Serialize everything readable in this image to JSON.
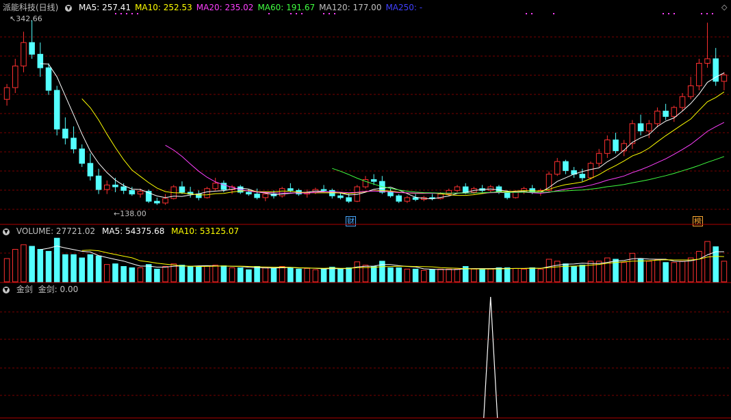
{
  "stock": {
    "name": "派能科技(日线)",
    "ma_labels": [
      {
        "text": "MA5: 257.41",
        "color": "#ffffff"
      },
      {
        "text": "MA10: 252.53",
        "color": "#ffff00"
      },
      {
        "text": "MA20: 235.02",
        "color": "#ff40ff"
      },
      {
        "text": "MA60: 191.67",
        "color": "#40ff40"
      },
      {
        "text": "MA120: 177.00",
        "color": "#c0c0c0"
      },
      {
        "text": "MA250: -",
        "color": "#4040ff"
      }
    ],
    "high_label": "342.66",
    "low_label": "138.00",
    "events": [
      {
        "label": "财"
      },
      {
        "label": "榜"
      }
    ]
  },
  "volume": {
    "title": "VOLUME: 27721.02",
    "ma5": "MA5: 54375.68",
    "ma10": "MA10: 53125.07"
  },
  "indicator": {
    "title": "金剑",
    "value_label": "金剑: 0.00"
  },
  "colors": {
    "up": "#ff3030",
    "down": "#54ffff",
    "grid": "#7a0000",
    "background": "#000000"
  },
  "chart_data": {
    "type": "candlestick",
    "note_symbol": "派能科技",
    "price_range": [
      138.0,
      342.66
    ],
    "candles": [
      [
        255,
        272,
        248,
        268
      ],
      [
        268,
        300,
        262,
        292
      ],
      [
        292,
        330,
        285,
        318
      ],
      [
        318,
        342.66,
        300,
        305
      ],
      [
        305,
        318,
        280,
        290
      ],
      [
        290,
        295,
        260,
        265
      ],
      [
        265,
        270,
        215,
        222
      ],
      [
        222,
        235,
        205,
        212
      ],
      [
        212,
        225,
        195,
        200
      ],
      [
        200,
        205,
        180,
        184
      ],
      [
        184,
        195,
        165,
        170
      ],
      [
        170,
        178,
        150,
        155
      ],
      [
        155,
        165,
        150,
        160
      ],
      [
        160,
        168,
        152,
        158
      ],
      [
        158,
        162,
        150,
        154
      ],
      [
        154,
        158,
        148,
        150
      ],
      [
        150,
        156,
        146,
        153
      ],
      [
        153,
        155,
        140,
        142
      ],
      [
        142,
        146,
        138,
        140
      ],
      [
        140,
        150,
        138.0,
        145
      ],
      [
        145,
        160,
        144,
        158
      ],
      [
        158,
        164,
        150,
        152
      ],
      [
        152,
        158,
        146,
        150
      ],
      [
        150,
        154,
        143,
        146
      ],
      [
        146,
        158,
        145,
        156
      ],
      [
        156,
        168,
        154,
        162
      ],
      [
        162,
        165,
        152,
        155
      ],
      [
        155,
        160,
        150,
        158
      ],
      [
        158,
        160,
        150,
        152
      ],
      [
        152,
        155,
        148,
        150
      ],
      [
        150,
        156,
        144,
        146
      ],
      [
        146,
        152,
        142,
        150
      ],
      [
        150,
        154,
        145,
        148
      ],
      [
        148,
        158,
        146,
        156
      ],
      [
        156,
        162,
        152,
        154
      ],
      [
        154,
        156,
        148,
        150
      ],
      [
        150,
        155,
        146,
        152
      ],
      [
        152,
        157,
        150,
        155
      ],
      [
        155,
        160,
        152,
        154
      ],
      [
        154,
        156,
        145,
        148
      ],
      [
        148,
        152,
        144,
        146
      ],
      [
        146,
        150,
        140,
        142
      ],
      [
        142,
        160,
        141,
        158
      ],
      [
        158,
        170,
        156,
        166
      ],
      [
        166,
        172,
        160,
        164
      ],
      [
        164,
        170,
        150,
        152
      ],
      [
        152,
        156,
        146,
        148
      ],
      [
        148,
        150,
        140,
        142
      ],
      [
        142,
        148,
        140,
        146
      ],
      [
        146,
        150,
        142,
        144
      ],
      [
        144,
        148,
        142,
        146
      ],
      [
        146,
        150,
        143,
        145
      ],
      [
        145,
        152,
        144,
        150
      ],
      [
        150,
        156,
        148,
        154
      ],
      [
        154,
        160,
        152,
        158
      ],
      [
        158,
        162,
        150,
        152
      ],
      [
        152,
        158,
        150,
        156
      ],
      [
        156,
        160,
        152,
        154
      ],
      [
        154,
        160,
        152,
        158
      ],
      [
        158,
        160,
        150,
        152
      ],
      [
        152,
        154,
        144,
        146
      ],
      [
        146,
        154,
        145,
        152
      ],
      [
        152,
        158,
        150,
        156
      ],
      [
        156,
        160,
        150,
        152
      ],
      [
        152,
        156,
        148,
        154
      ],
      [
        154,
        175,
        152,
        172
      ],
      [
        172,
        190,
        170,
        186
      ],
      [
        186,
        188,
        172,
        176
      ],
      [
        176,
        180,
        168,
        172
      ],
      [
        172,
        178,
        164,
        168
      ],
      [
        168,
        186,
        166,
        184
      ],
      [
        184,
        200,
        180,
        195
      ],
      [
        195,
        215,
        190,
        210
      ],
      [
        210,
        218,
        195,
        198
      ],
      [
        198,
        210,
        192,
        206
      ],
      [
        206,
        232,
        200,
        228
      ],
      [
        228,
        238,
        215,
        220
      ],
      [
        220,
        232,
        212,
        228
      ],
      [
        228,
        246,
        224,
        242
      ],
      [
        242,
        250,
        232,
        236
      ],
      [
        236,
        248,
        230,
        246
      ],
      [
        246,
        262,
        242,
        258
      ],
      [
        258,
        280,
        255,
        270
      ],
      [
        270,
        300,
        265,
        295
      ],
      [
        295,
        340,
        290,
        300
      ],
      [
        300,
        312,
        270,
        275
      ],
      [
        275,
        285,
        265,
        282
      ]
    ],
    "ma5": [],
    "volume_values": [],
    "indicator_spike_index": 58
  }
}
